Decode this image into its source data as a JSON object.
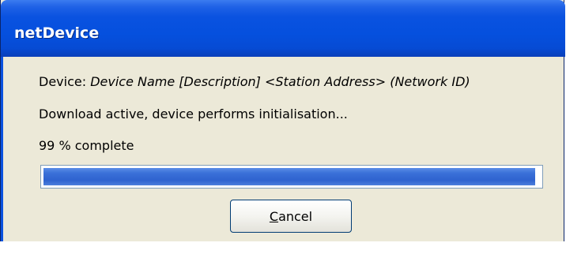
{
  "dialog": {
    "title": "netDevice",
    "device_prefix": "Device: ",
    "device_value": "Device Name [Description] <Station Address> (Network ID)",
    "status_text": "Download active, device performs initialisation...",
    "progress_text": "99 % complete",
    "progress_percent": 99,
    "cancel_mnemonic": "C",
    "cancel_rest": "ancel"
  },
  "colors": {
    "titlebar": "#0550de",
    "progress_fill": "#2f63cf",
    "window_bg": "#ece9d8"
  }
}
